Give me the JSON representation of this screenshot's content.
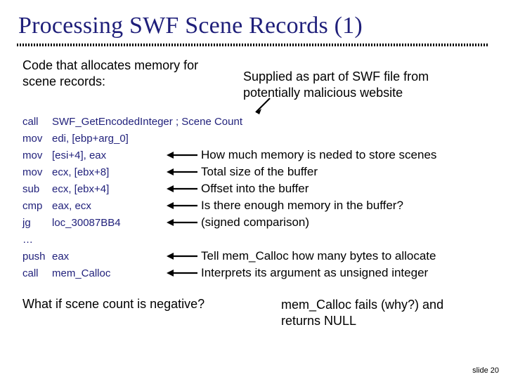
{
  "title": "Processing SWF Scene Records (1)",
  "intro_left": "Code that allocates memory for scene records:",
  "intro_right_l1": "Supplied as part of SWF file from",
  "intro_right_l2": "potentially malicious website",
  "code": {
    "r0": {
      "m": "call",
      "o": "SWF_GetEncodedInteger",
      "c": "; Scene Count"
    },
    "r1": {
      "m": "mov",
      "o": "edi, [ebp+arg_0]"
    },
    "r2": {
      "m": "mov",
      "o": "[esi+4], eax",
      "c": "How much memory is neded to store scenes"
    },
    "r3": {
      "m": "mov",
      "o": "ecx, [ebx+8]",
      "c": "Total size of the buffer"
    },
    "r4": {
      "m": "sub",
      "o": "ecx, [ebx+4]",
      "c": "Offset into the buffer"
    },
    "r5": {
      "m": "cmp",
      "o": "eax, ecx",
      "c": "Is there enough memory in the buffer?"
    },
    "r6": {
      "m": "jg",
      "o": "loc_30087BB4",
      "c": "(signed comparison)"
    },
    "r7": {
      "m": "…",
      "o": ""
    },
    "r8": {
      "m": "push",
      "o": "eax",
      "c": "Tell mem_Calloc how many bytes to allocate"
    },
    "r9": {
      "m": "call",
      "o": "mem_Calloc",
      "c": "Interprets its argument as unsigned integer"
    }
  },
  "bottom_left": "What if scene count is negative?",
  "bottom_right_l1": "mem_Calloc fails (why?) and",
  "bottom_right_l2": "returns NULL",
  "slide_num": "slide 20"
}
